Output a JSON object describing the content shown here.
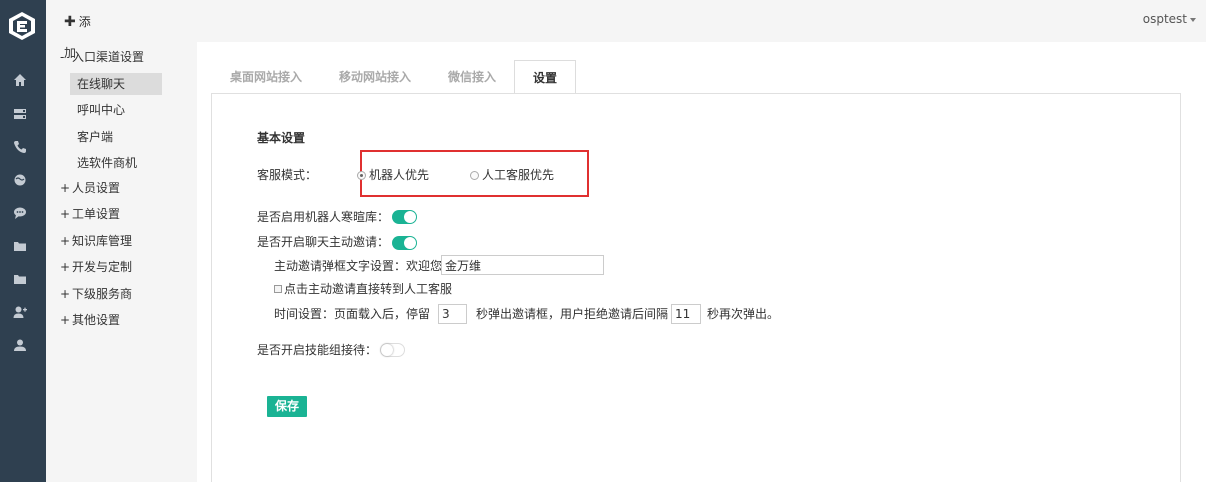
{
  "user": {
    "name": "osptest"
  },
  "sidebar": {
    "add_label": "添",
    "add_label_2": "加",
    "groups": [
      {
        "sign": "-",
        "label": "入口渠道设置"
      },
      {
        "sign": "+",
        "label": "人员设置"
      },
      {
        "sign": "+",
        "label": "工单设置"
      },
      {
        "sign": "+",
        "label": "知识库管理"
      },
      {
        "sign": "+",
        "label": "开发与定制"
      },
      {
        "sign": "+",
        "label": "下级服务商"
      },
      {
        "sign": "+",
        "label": "其他设置"
      }
    ],
    "sub_items": [
      {
        "label": "在线聊天"
      },
      {
        "label": "呼叫中心"
      },
      {
        "label": "客户端"
      },
      {
        "label": "选软件商机"
      }
    ]
  },
  "rail_icons": [
    "home-icon",
    "server-icon",
    "phone-icon",
    "globe-icon",
    "chat-icon",
    "folder-icon",
    "folder-icon",
    "user-add-icon",
    "users-icon"
  ],
  "tabs": [
    {
      "label": "桌面网站接入"
    },
    {
      "label": "移动网站接入"
    },
    {
      "label": "微信接入"
    },
    {
      "label": "设置"
    }
  ],
  "settings": {
    "section_title": "基本设置",
    "service_mode_label": "客服模式：",
    "mode_options": [
      {
        "label": "机器人优先",
        "selected": true
      },
      {
        "label": "人工客服优先",
        "selected": false
      }
    ],
    "robot_greeting_label": "是否启用机器人寒暄库：",
    "robot_greeting_on": true,
    "chat_invite_label": "是否开启聊天主动邀请：",
    "chat_invite_on": true,
    "invite_text_label": "主动邀请弹框文字设置：欢迎您咨询",
    "invite_text_value": "金万维",
    "direct_transfer_label": "点击主动邀请直接转到人工客服",
    "time_prefix": "时间设置：页面载入后，停留",
    "time_delay_value": "3",
    "time_middle": "秒弹出邀请框，用户拒绝邀请后间隔",
    "time_interval_value": "11",
    "time_suffix": "秒再次弹出。",
    "skill_group_label": "是否开启技能组接待：",
    "skill_group_on": false,
    "save_label": "保存"
  },
  "colors": {
    "accent": "#1ab394",
    "rail": "#2f4050",
    "highlight": "#e03030"
  }
}
